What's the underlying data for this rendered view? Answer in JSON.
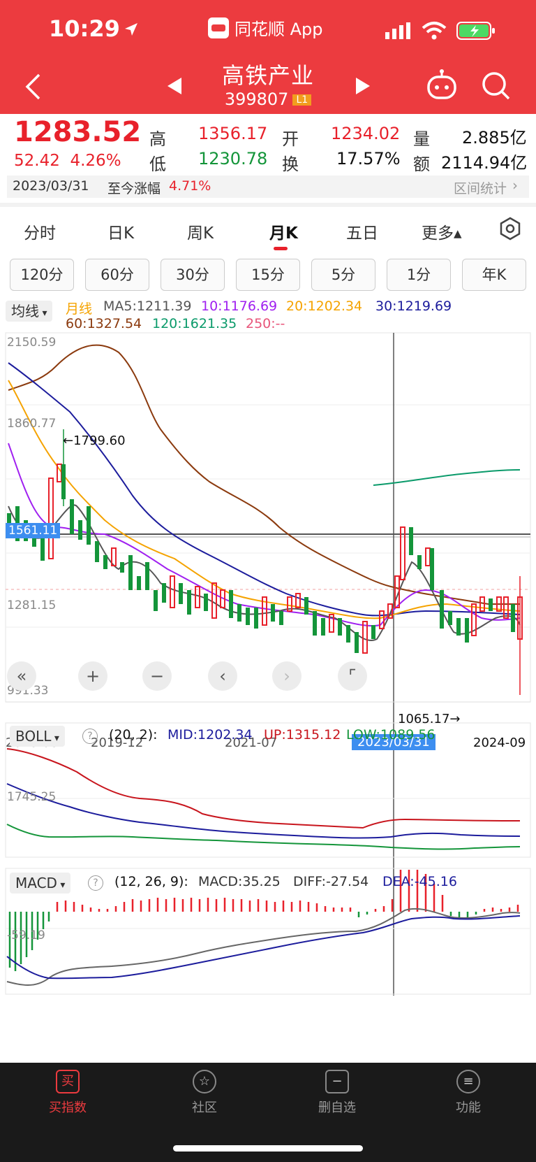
{
  "status": {
    "time": "10:29",
    "app_name": "同花顺 App"
  },
  "header": {
    "title": "高铁产业",
    "code": "399807",
    "level_badge": "L1"
  },
  "quote": {
    "price": "1283.52",
    "change": "52.42",
    "change_pct": "4.26%",
    "high_label": "高",
    "high": "1356.17",
    "low_label": "低",
    "low": "1230.78",
    "open_label": "开",
    "open": "1234.02",
    "turnover_label": "换",
    "turnover": "17.57%",
    "volume_label": "量",
    "volume": "2.885亿",
    "amount_label": "额",
    "amount": "2114.94亿",
    "date": "2023/03/31",
    "since_label": "至今涨幅",
    "since_value": "4.71%",
    "range_stats": "区间统计"
  },
  "tabs": [
    "分时",
    "日K",
    "周K",
    "月K",
    "五日",
    "更多▴"
  ],
  "active_tab": 3,
  "periods": [
    "120分",
    "60分",
    "30分",
    "15分",
    "5分",
    "1分",
    "年K"
  ],
  "ma_legend": {
    "selector": "均线",
    "type": "月线",
    "ma5": "MA5:1211.39",
    "ma10": "10:1176.69",
    "ma20": "20:1202.34",
    "ma30": "30:1219.69",
    "ma60": "60:1327.54",
    "ma120": "120:1621.35",
    "ma250": "250:--"
  },
  "main_chart": {
    "y_labels": [
      "2150.59",
      "1860.77",
      "1281.15",
      "991.33"
    ],
    "cursor_price": "1561.11",
    "max_marker": "←1799.60",
    "min_marker": "1065.17→",
    "x_labels": [
      "2018-08",
      "2019-12",
      "2021-07",
      "2024-09"
    ],
    "cursor_date": "2023/03/31"
  },
  "boll": {
    "selector": "BOLL",
    "params": "(20, 2):",
    "mid": "MID:1202.34",
    "up": "UP:1315.12",
    "low": "LOW:1089.56",
    "y_label": "1745.25"
  },
  "macd": {
    "selector": "MACD",
    "params": "(12, 26, 9):",
    "macd": "MACD:35.25",
    "diff": "DIFF:-27.54",
    "dea": "DEA:-45.16",
    "y_label": "-59.19"
  },
  "nav_buttons": [
    "«",
    "+",
    "−",
    "‹",
    "›",
    "⌜"
  ],
  "bottom_nav": [
    {
      "label": "买指数",
      "icon": "买"
    },
    {
      "label": "社区",
      "icon": "☆"
    },
    {
      "label": "删自选",
      "icon": "−"
    },
    {
      "label": "功能",
      "icon": "≡"
    }
  ],
  "colors": {
    "up": "#e8212b",
    "down": "#14953a",
    "header": "#ec3b3f",
    "ma5": "#555555",
    "ma10": "#a020f0",
    "ma20": "#f5a300",
    "ma30": "#1c1c9c",
    "ma60": "#8b3a0e",
    "ma120": "#0a9a6a"
  },
  "chart_data": {
    "type": "candlestick",
    "ylim": [
      991.33,
      2150.59
    ],
    "ma_series_visible": [
      "MA5",
      "MA10",
      "MA20",
      "MA30",
      "MA60",
      "MA120"
    ]
  }
}
